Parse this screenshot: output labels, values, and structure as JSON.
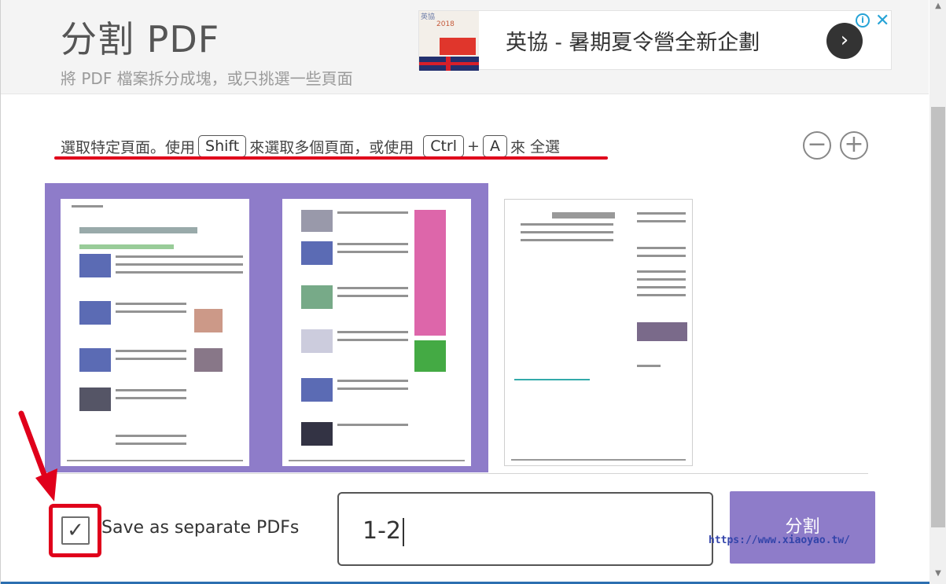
{
  "header": {
    "title": "分割 PDF",
    "subtitle": "將 PDF 檔案拆分成塊，或只挑選一些頁面"
  },
  "ad": {
    "headline": "英協 - 暑期夏令營全新企劃",
    "thumb_line1": "英協",
    "thumb_line2": "2018",
    "info_icon": "info-icon",
    "close_icon": "close-icon",
    "arrow_icon": "chevron-right-icon"
  },
  "instructions": {
    "part1": "選取特定頁面。使用",
    "key_shift": "Shift",
    "part2": "來選取多個頁面，或使用",
    "key_ctrl": "Ctrl",
    "plus": "+",
    "key_a": "A",
    "part3": "來",
    "select_all": "全選"
  },
  "zoom": {
    "out_symbol": "−",
    "in_symbol": "+"
  },
  "pages": [
    {
      "selected": true
    },
    {
      "selected": true
    },
    {
      "selected": false
    }
  ],
  "options": {
    "save_separate_label": "Save as separate PDFs",
    "save_separate_checked": true,
    "check_mark": "✓"
  },
  "range_input": {
    "value": "1-2"
  },
  "split_button": {
    "label": "分割"
  },
  "watermark": "https://www.xiaoyao.tw/",
  "colors": {
    "accent": "#8e7cc9",
    "highlight_red": "#e0001b"
  }
}
